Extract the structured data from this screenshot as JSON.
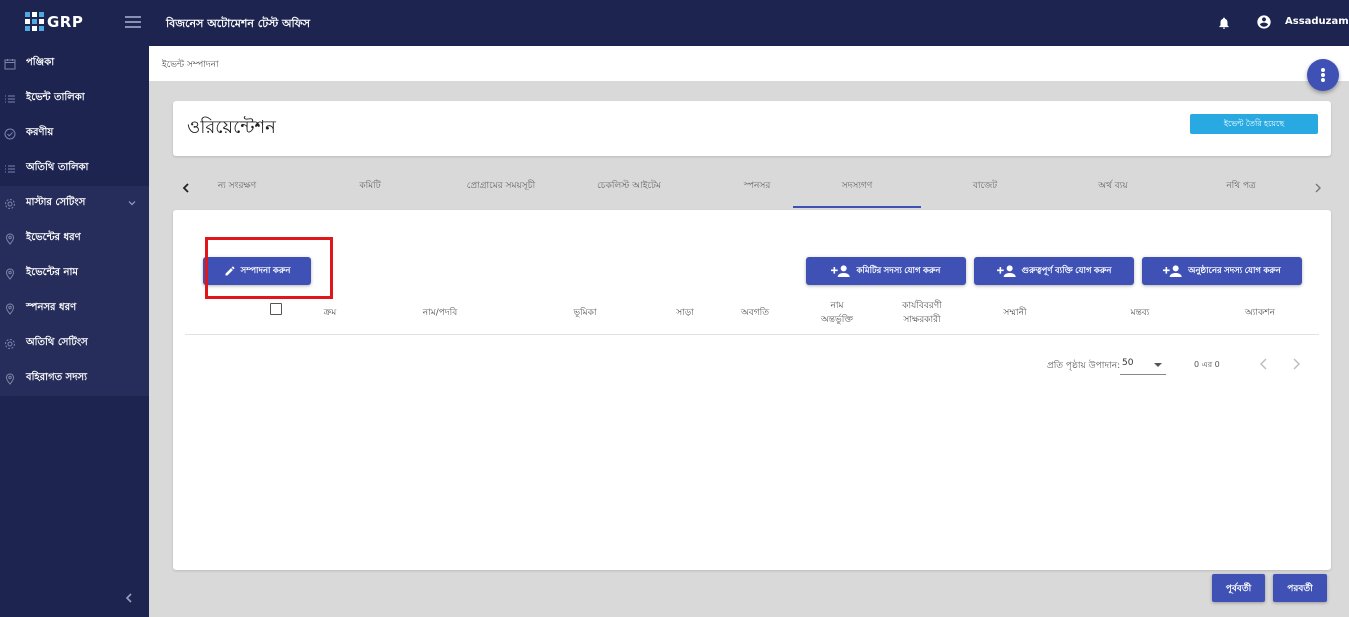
{
  "app": {
    "logo": "GRP",
    "title": "বিজনেস অটোমেশন টেস্ট অফিস",
    "username": "Assaduzaman"
  },
  "sidebar": {
    "items": [
      {
        "label": "পঞ্জিকা",
        "icon": "calendar-icon"
      },
      {
        "label": "ইভেন্ট তালিকা",
        "icon": "list-icon"
      },
      {
        "label": "করণীয়",
        "icon": "check-circle-icon"
      },
      {
        "label": "অতিথি তালিকা",
        "icon": "list-icon"
      },
      {
        "label": "মাস্টার সেটিংস",
        "icon": "gear-icon"
      },
      {
        "label": "ইভেন্টের ধরণ",
        "icon": "location-pin-icon"
      },
      {
        "label": "ইভেন্টের নাম",
        "icon": "location-pin-icon"
      },
      {
        "label": "স্পনসর ধরণ",
        "icon": "location-pin-icon"
      },
      {
        "label": "অতিথি সেটিংস",
        "icon": "gear-icon"
      },
      {
        "label": "বহিরাগত সদস্য",
        "icon": "location-pin-icon"
      }
    ]
  },
  "breadcrumb": "ইভেন্ট সম্পাদনা",
  "page": {
    "title": "ওরিয়েন্টেশন",
    "status_button": "ইভেন্ট তৈরি হয়েছে"
  },
  "tabs": [
    {
      "label": "ন্য সংরক্ষণ"
    },
    {
      "label": "কমিটি"
    },
    {
      "label": "প্রোগ্রামের সময়সূচী"
    },
    {
      "label": "চেকলিস্ট আইটেম"
    },
    {
      "label": "স্পনসর"
    },
    {
      "label": "সদস্যগণ",
      "active": true
    },
    {
      "label": "বাজেট"
    },
    {
      "label": "অর্থ ব্যয়"
    },
    {
      "label": "নথি পত্র"
    }
  ],
  "actions": {
    "edit": "সম্পাদনা করুন",
    "add_committee_member": "কমিটির সদস্য যোগ করুন",
    "add_important_person": "গুরুত্বপূর্ণ ব্যক্তি যোগ করুন",
    "add_event_member": "অনুষ্ঠানের সদস্য যোগ করুন"
  },
  "table": {
    "columns": {
      "serial": "ক্রম",
      "name": "নাম/পদবি",
      "role": "ভূমিকা",
      "response": "সাড়া",
      "informed": "অবগতি",
      "name_include_1": "নাম",
      "name_include_2": "অন্তর্ভুক্তি",
      "minutes_1": "কার্যবিবরণী",
      "minutes_2": "সাক্ষরকারী",
      "honorarium": "সম্মানী",
      "remarks": "মন্তব্য",
      "action": "অ্যাকশন"
    }
  },
  "paginator": {
    "label": "প্রতি পৃষ্ঠায় উপাদান:",
    "page_size": "50",
    "range": "0 এর 0"
  },
  "footer": {
    "previous": "পূর্ববর্তী",
    "next": "পরবর্তী"
  },
  "colors": {
    "primary": "#3f51b5",
    "nav_bg": "#1d2450",
    "status": "#29a9e1",
    "highlight": "#e0161b"
  }
}
